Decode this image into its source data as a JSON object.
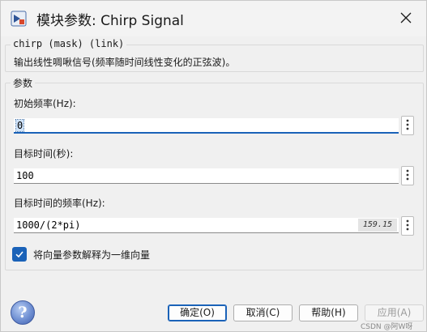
{
  "window": {
    "title": "模块参数: Chirp Signal"
  },
  "description_group": {
    "legend": "chirp (mask) (link)",
    "text": "输出线性啁啾信号(频率随时间线性变化的正弦波)。"
  },
  "parameters_group": {
    "legend": "参数",
    "fields": [
      {
        "label": "初始频率(Hz):",
        "value": "0"
      },
      {
        "label": "目标时间(秒):",
        "value": "100"
      },
      {
        "label": "目标时间的频率(Hz):",
        "value": "1000/(2*pi)",
        "evaluated": "159.15"
      }
    ],
    "checkbox": {
      "label": "将向量参数解释为一维向量",
      "checked": true
    }
  },
  "buttons": {
    "ok": "确定(O)",
    "cancel": "取消(C)",
    "help": "帮助(H)",
    "apply": "应用(A)"
  },
  "help_glyph": "?",
  "watermark": "CSDN @阿W呀",
  "colors": {
    "accent": "#1a62b8",
    "window_bg": "#f0f0f0"
  },
  "icons": {
    "app": "simulink-block-icon",
    "close": "close-icon",
    "more": "vertical-ellipsis-icon",
    "help": "help-question-icon",
    "check": "checkmark-icon"
  }
}
